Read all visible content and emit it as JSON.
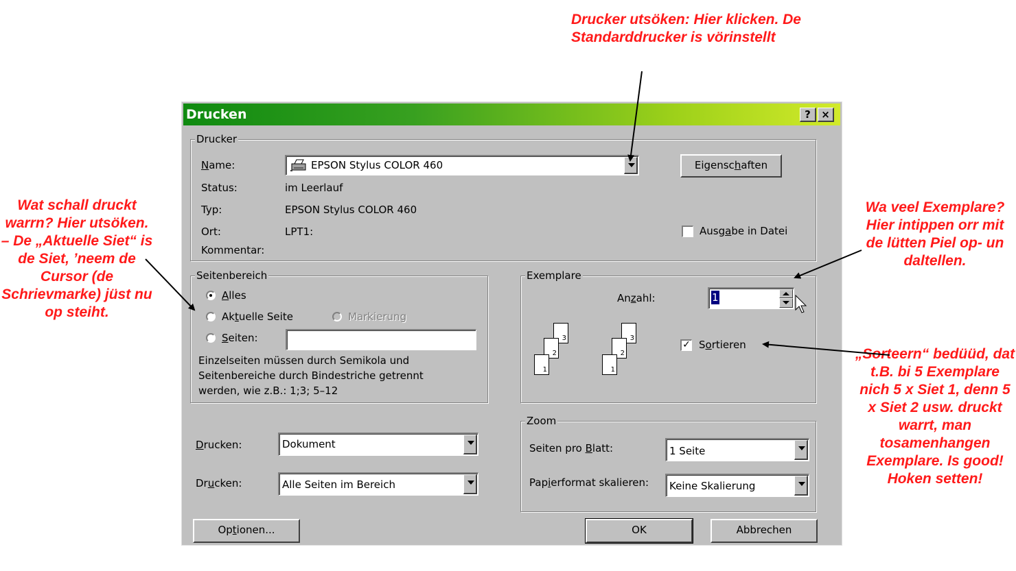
{
  "annotations": {
    "top": "Drucker utsöken: Hier klicken. De Standarddrucker is vörinstellt",
    "left": "Wat schall druckt warrn? Hier utsöken. – De „Aktuelle Siet“ is de Siet, ’neem de Cursor (de Schrievmarke) jüst nu op steiht.",
    "right_copies": "Wa veel Exemplare? Hier intippen orr mit de lütten Piel op- un daltellen.",
    "right_sort": "„Sorteern“ bedüüd, dat t.B. bi 5 Exemplare nich 5 x Siet 1, denn 5 x Siet 2 usw. druckt warrt, man tosamenhangen Exemplare. Is good! Hoken setten!"
  },
  "dialog": {
    "title": "Drucken",
    "help_button": "?",
    "close_button": "×",
    "printer": {
      "group_label": "Drucker",
      "name_label_pre": "",
      "name_label_u": "N",
      "name_label_post": "ame:",
      "name_value": "EPSON Stylus COLOR 460",
      "status_label": "Status:",
      "status_value": "im Leerlauf",
      "type_label": "Typ:",
      "type_value": "EPSON Stylus COLOR 460",
      "location_label": "Ort:",
      "location_value": "LPT1:",
      "comment_label": "Kommentar:",
      "properties_button_pre": "Eigensc",
      "properties_button_u": "h",
      "properties_button_post": "aften",
      "print_to_file_pre": "Ausg",
      "print_to_file_u": "a",
      "print_to_file_post": "be in Datei",
      "print_to_file_checked": false
    },
    "page_range": {
      "group_label": "Seitenbereich",
      "all_u": "A",
      "all_post": "lles",
      "current_pre": "Ak",
      "current_u": "t",
      "current_post": "uelle Seite",
      "selection": "Markierung",
      "pages_u": "S",
      "pages_post": "eiten:",
      "pages_value": "",
      "selected": "all",
      "help_line1": "Einzelseiten müssen durch Semikola und",
      "help_line2": "Seitenbereiche durch Bindestriche getrennt",
      "help_line3": "werden, wie z.B.: 1;3; 5–12"
    },
    "copies": {
      "group_label": "Exemplare",
      "count_label_pre": "An",
      "count_label_u": "z",
      "count_label_post": "ahl:",
      "count_value": "1",
      "collate_pre": "S",
      "collate_u": "o",
      "collate_post": "rtieren",
      "collate_checked": true,
      "collate_check_glyph": "✓",
      "icon_pages": [
        "3",
        "2",
        "1"
      ]
    },
    "print_what": {
      "label_u": "D",
      "label_post": "rucken:",
      "value": "Dokument"
    },
    "print_range": {
      "label_pre": "Dr",
      "label_u": "u",
      "label_post": "cken:",
      "value": "Alle Seiten im Bereich"
    },
    "zoom": {
      "group_label": "Zoom",
      "pages_per_sheet_label_pre": "Seiten pro ",
      "pages_per_sheet_label_u": "B",
      "pages_per_sheet_label_post": "latt:",
      "pages_per_sheet_value": "1 Seite",
      "scale_label_pre": "Pap",
      "scale_label_u": "i",
      "scale_label_post": "erformat skalieren:",
      "scale_value": "Keine Skalierung"
    },
    "options_button_pre": "Op",
    "options_button_u": "t",
    "options_button_post": "ionen...",
    "ok_button": "OK",
    "cancel_button": "Abbrechen"
  }
}
